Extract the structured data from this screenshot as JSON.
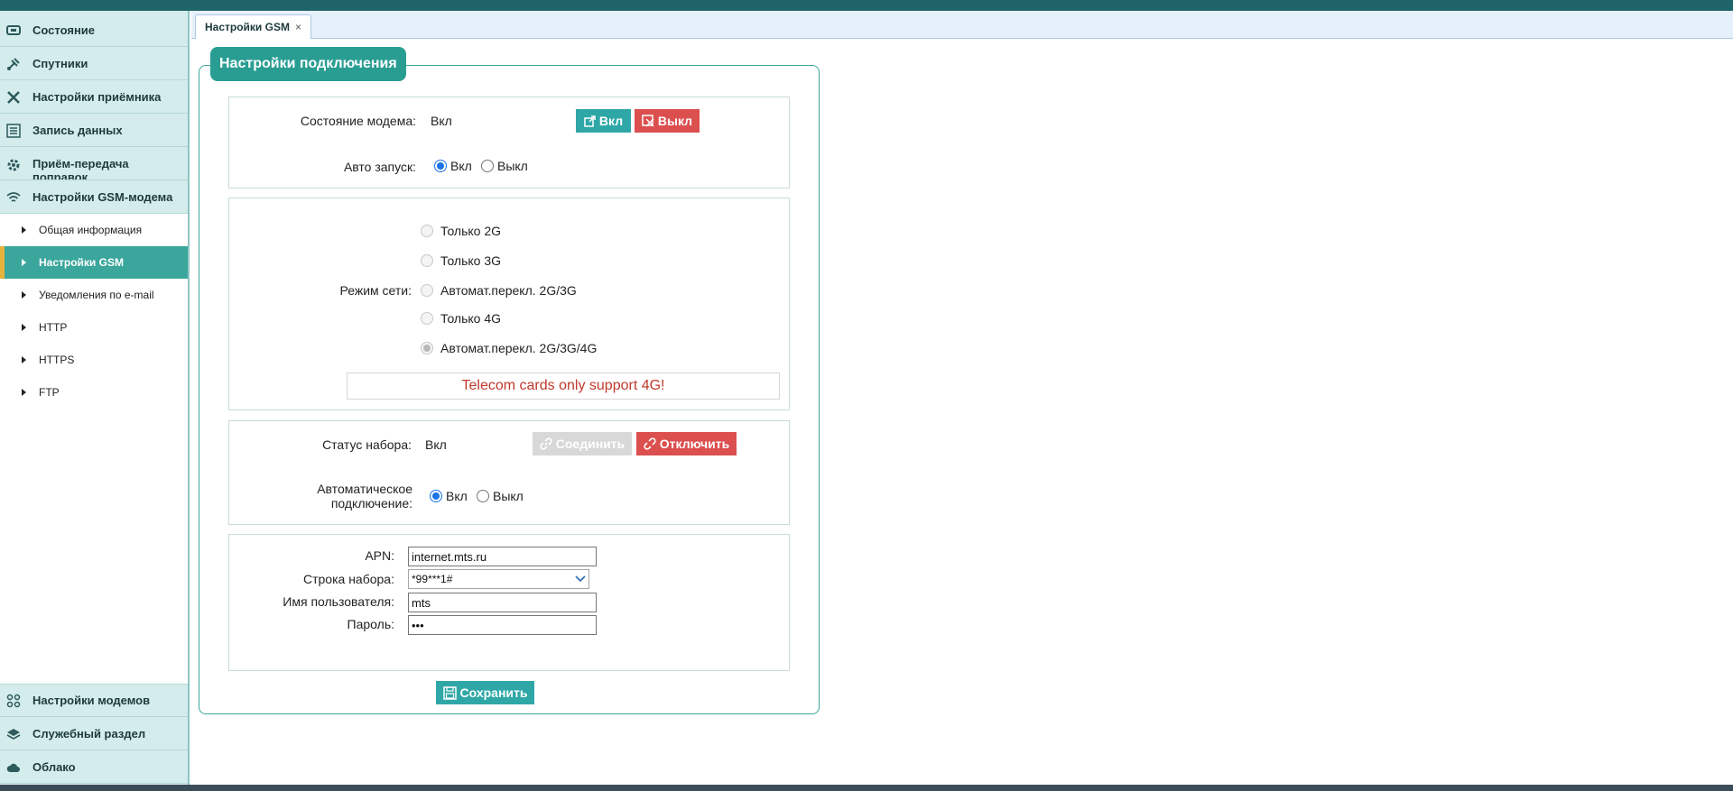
{
  "sidebar": {
    "items": [
      {
        "label": "Состояние",
        "icon": "monitor-icon"
      },
      {
        "label": "Спутники",
        "icon": "satellite-icon"
      },
      {
        "label": "Настройки приёмника",
        "icon": "tools-icon"
      },
      {
        "label": "Запись данных",
        "icon": "list-icon"
      },
      {
        "label": "Приём-передача поправок",
        "icon": "gear-icon"
      },
      {
        "label": "Настройки GSM-модема",
        "icon": "wifi-icon"
      }
    ],
    "subitems": [
      {
        "label": "Общая информация"
      },
      {
        "label": "Настройки GSM",
        "active": true
      },
      {
        "label": "Уведомления по e-mail"
      },
      {
        "label": "HTTP"
      },
      {
        "label": "HTTPS"
      },
      {
        "label": "FTP"
      }
    ],
    "bottom_items": [
      {
        "label": "Настройки модемов",
        "icon": "grid-icon"
      },
      {
        "label": "Служебный раздел",
        "icon": "layers-icon"
      },
      {
        "label": "Облако",
        "icon": "cloud-icon"
      }
    ]
  },
  "tab": {
    "label": "Настройки GSM",
    "close": "×"
  },
  "panel": {
    "title": "Настройки подключения"
  },
  "modem": {
    "state_label": "Состояние модема:",
    "state_value": "Вкл",
    "on_button": "Вкл",
    "off_button": "Выкл",
    "autostart_label": "Авто запуск:",
    "autostart_on": "Вкл",
    "autostart_off": "Выкл",
    "autostart_selected": "on"
  },
  "network": {
    "mode_label": "Режим сети:",
    "options": [
      {
        "label": "Только 2G",
        "selected": false
      },
      {
        "label": "Только 3G",
        "selected": false
      },
      {
        "label": "Автомат.перекл. 2G/3G",
        "selected": false
      },
      {
        "label": "Только 4G",
        "selected": false
      },
      {
        "label": "Автомат.перекл. 2G/3G/4G",
        "selected": true
      }
    ],
    "notice": "Telecom cards only support 4G!"
  },
  "dial": {
    "status_label": "Статус набора:",
    "status_value": "Вкл",
    "connect_button": "Соединить",
    "disconnect_button": "Отключить",
    "auto_label_line1": "Автоматическое",
    "auto_label_line2": "подключение:",
    "auto_on": "Вкл",
    "auto_off": "Выкл",
    "auto_selected": "on"
  },
  "apn": {
    "apn_label": "APN:",
    "apn_value": "internet.mts.ru",
    "dial_label": "Строка набора:",
    "dial_value": "*99***1#",
    "user_label": "Имя пользователя:",
    "user_value": "mts",
    "password_label": "Пароль:",
    "password_value": "•••"
  },
  "save_button": "Сохранить",
  "colors": {
    "accent": "#2a9d93",
    "danger": "#dc4f4f",
    "active_marker": "#e8b33c",
    "notice": "#c0392b"
  }
}
